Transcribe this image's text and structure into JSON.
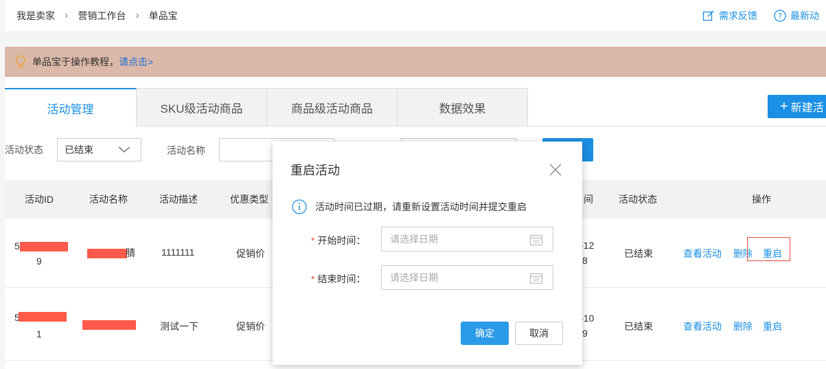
{
  "breadcrumb": [
    "我是卖家",
    "营销工作台",
    "单品宝"
  ],
  "top_links": {
    "feedback": "需求反馈",
    "latest": "最新动"
  },
  "notice": {
    "text": "单品宝于操作教程，",
    "link": "请点击>"
  },
  "tabs": [
    "活动管理",
    "SKU级活动商品",
    "商品级活动商品",
    "数据效果"
  ],
  "new_button": "新建活",
  "filter": {
    "status_label": "活动状态",
    "status_value": "已结束",
    "name_label": "活动名称"
  },
  "table": {
    "headers": [
      "活动ID",
      "活动名称",
      "活动描述",
      "优惠类型",
      "间",
      "活动状态",
      "操作"
    ],
    "rows": [
      {
        "id_prefix": "5",
        "id_suffix": "9",
        "name_tail": "腈",
        "desc": "1111111",
        "type": "促销价",
        "time_a": "-12",
        "time_b": "8",
        "status": "已结束"
      },
      {
        "id_prefix": "5",
        "id_suffix": "1",
        "name_tail": "",
        "desc": "测试一下",
        "type": "促销价",
        "time_a": "-10",
        "time_b": "9",
        "status": "已结束"
      }
    ],
    "actions": {
      "view": "查看活动",
      "delete": "删除",
      "restart": "重启"
    }
  },
  "modal": {
    "title": "重启活动",
    "info": "活动时间已过期，请重新设置活动时间并提交重启",
    "required_mark": "*",
    "start_label": "开始时间：",
    "end_label": "结束时间：",
    "date_placeholder": "请选择日期",
    "ok": "确定",
    "cancel": "取消"
  },
  "colors": {
    "accent": "#1a8fe3",
    "notice_bg": "#dbb8a8",
    "required": "#e84a3c",
    "redaction": "#ff5a4a"
  }
}
